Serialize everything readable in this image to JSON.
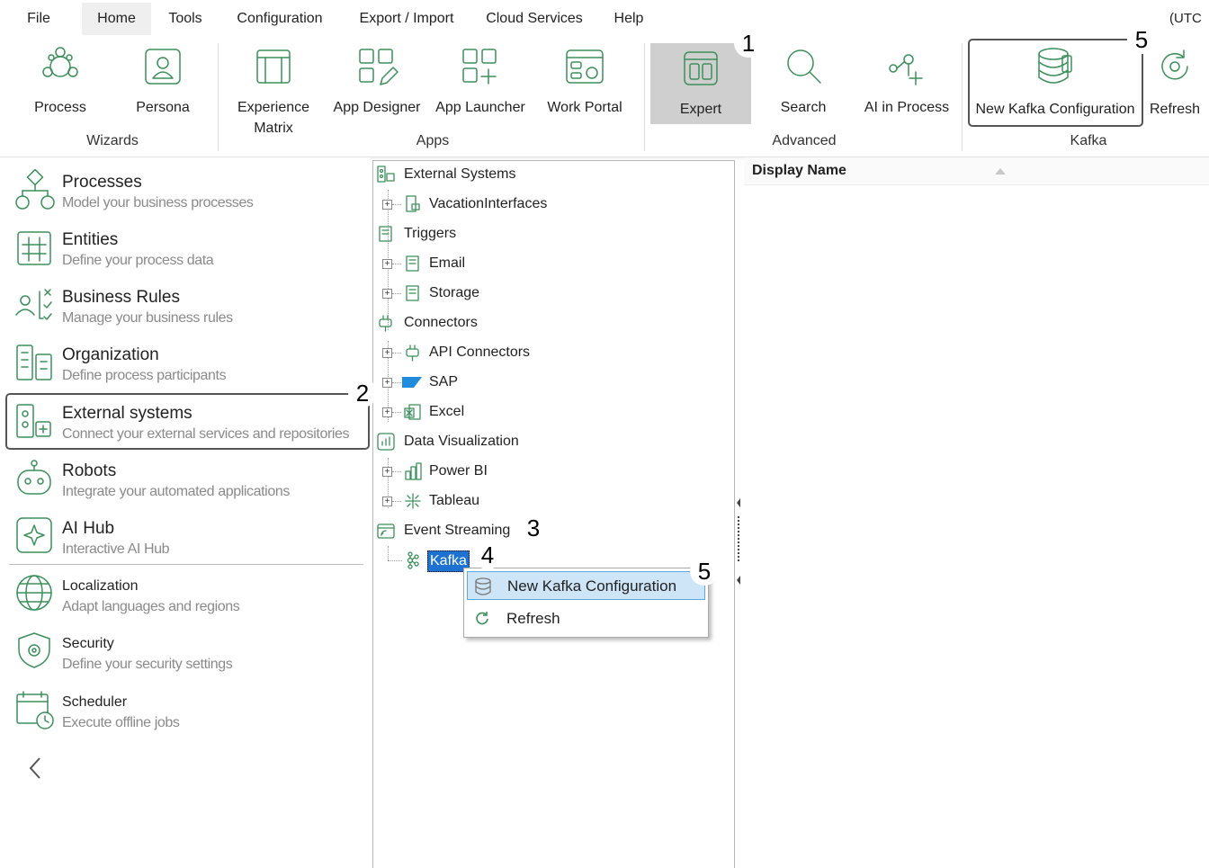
{
  "menu": {
    "items": [
      "File",
      "Home",
      "Tools",
      "Configuration",
      "Export / Import",
      "Cloud Services",
      "Help"
    ],
    "timezone": "(UTC"
  },
  "ribbon": {
    "wizards": {
      "group": "Wizards",
      "process": "Process",
      "persona": "Persona"
    },
    "apps": {
      "group": "Apps",
      "experience_matrix": [
        "Experience",
        "Matrix"
      ],
      "app_designer": "App Designer",
      "app_launcher": "App Launcher",
      "work_portal": "Work Portal"
    },
    "advanced": {
      "group": "Advanced",
      "expert": "Expert",
      "search": "Search",
      "ai_in_process": "AI in Process"
    },
    "kafka": {
      "group": "Kafka",
      "new_kafka": "New Kafka Configuration",
      "refresh": "Refresh"
    }
  },
  "nav": [
    {
      "title": "Processes",
      "sub": "Model your business processes",
      "icon": "process-icon"
    },
    {
      "title": "Entities",
      "sub": "Define your process data",
      "icon": "entities-icon"
    },
    {
      "title": "Business Rules",
      "sub": "Manage your business rules",
      "icon": "business-rules-icon"
    },
    {
      "title": "Organization",
      "sub": "Define process participants",
      "icon": "organization-icon"
    },
    {
      "title": "External systems",
      "sub": "Connect your external services and repositories",
      "icon": "external-systems-icon"
    },
    {
      "title": "Robots",
      "sub": "Integrate your automated applications",
      "icon": "robot-icon"
    },
    {
      "title": "AI Hub",
      "sub": "Interactive AI Hub",
      "icon": "ai-hub-icon"
    },
    {
      "title": "Localization",
      "sub": "Adapt languages and regions",
      "icon": "globe-icon"
    },
    {
      "title": "Security",
      "sub": "Define your security settings",
      "icon": "security-icon"
    },
    {
      "title": "Scheduler",
      "sub": "Execute offline jobs",
      "icon": "scheduler-icon"
    }
  ],
  "tree": {
    "external_systems": "External Systems",
    "vacation_interfaces": "VacationInterfaces",
    "triggers": "Triggers",
    "email": "Email",
    "storage": "Storage",
    "connectors": "Connectors",
    "api_connectors": "API Connectors",
    "sap": "SAP",
    "excel": "Excel",
    "data_visualization": "Data Visualization",
    "power_bi": "Power BI",
    "tableau": "Tableau",
    "event_streaming": "Event Streaming",
    "kafka": "Kafka"
  },
  "context_menu": {
    "new_kafka": "New Kafka Configuration",
    "refresh": "Refresh"
  },
  "grid": {
    "column": "Display Name"
  },
  "callouts": [
    "1",
    "2",
    "3",
    "4",
    "5",
    "5"
  ],
  "colors": {
    "accent": "#3b8f5a",
    "selection": "#1e73d2",
    "hover": "#cde5f7"
  }
}
